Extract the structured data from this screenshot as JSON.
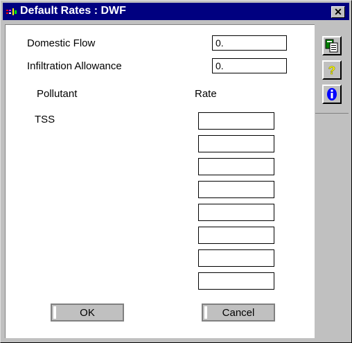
{
  "window": {
    "title": "Default Rates : DWF",
    "close_glyph": "✕"
  },
  "flows": [
    {
      "label": "Domestic Flow",
      "value": "0."
    },
    {
      "label": "Infiltration Allowance",
      "value": "0."
    }
  ],
  "pollutants": {
    "header_pollutant": "Pollutant",
    "header_rate": "Rate",
    "rows": [
      {
        "name": "TSS",
        "rate": ""
      },
      {
        "name": "",
        "rate": ""
      },
      {
        "name": "",
        "rate": ""
      },
      {
        "name": "",
        "rate": ""
      },
      {
        "name": "",
        "rate": ""
      },
      {
        "name": "",
        "rate": ""
      },
      {
        "name": "",
        "rate": ""
      },
      {
        "name": "",
        "rate": ""
      }
    ]
  },
  "buttons": {
    "ok": "OK",
    "cancel": "Cancel"
  },
  "toolbar": {
    "icons": [
      "copy-pages-icon",
      "help-question-icon",
      "info-icon"
    ],
    "colors": {
      "green": "#008000",
      "yellow": "#ffff00",
      "blue": "#0000ff"
    }
  }
}
